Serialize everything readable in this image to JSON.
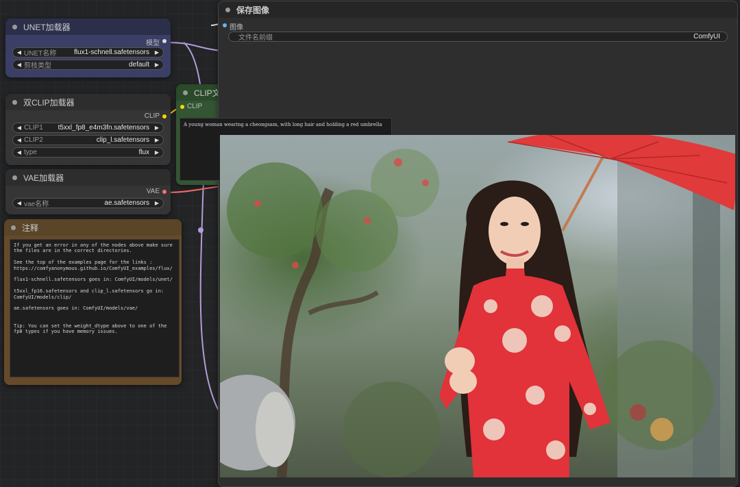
{
  "unet_loader": {
    "title": "UNET加载器",
    "output_label": "模型",
    "widgets": [
      {
        "label": "UNET名称",
        "value": "flux1-schnell.safetensors"
      },
      {
        "label": "剪枝类型",
        "value": "default"
      }
    ]
  },
  "dual_clip_loader": {
    "title": "双CLIP加载器",
    "output_label": "CLIP",
    "widgets": [
      {
        "label": "CLIP1",
        "value": "t5xxl_fp8_e4m3fn.safetensors"
      },
      {
        "label": "CLIP2",
        "value": "clip_l.safetensors"
      },
      {
        "label": "type",
        "value": "flux"
      }
    ]
  },
  "vae_loader": {
    "title": "VAE加载器",
    "output_label": "VAE",
    "widgets": [
      {
        "label": "vae名称",
        "value": "ae.safetensors"
      }
    ]
  },
  "note": {
    "title": "注释",
    "text": "If you get an error in any of the nodes above make sure the files are in the correct directories.\n\nSee the top of the examples page for the links :\nhttps://comfyanonymous.github.io/ComfyUI_examples/flux/\n\nflux1-schnell.safetensors goes in: ComfyUI/models/unet/\n\nt5xxl_fp16.safetensors and clip_l.safetensors go in:\nComfyUI/models/clip/\n\nae.safetensors goes in: ComfyUI/models/vae/\n\n\nTip: You can set the weight_dtype above to one of the fp8 types if you have memory issues."
  },
  "clip_text_encode": {
    "title": "CLIP文本",
    "input_label": "CLIP",
    "prompt": "A young woman wearing a cheongsam, with long hair and holding a red umbrella"
  },
  "save_image": {
    "title": "保存图像",
    "input_label": "图像",
    "widget": {
      "label": "文件名前缀",
      "value": "ComfyUI"
    }
  },
  "colors": {
    "model_wire": "#b39ddb",
    "clip_wire": "#ffd500",
    "vae_wire": "#ff6e6e",
    "image_wire": "#64b5f6",
    "unet_header": "#2b2f4a",
    "unet_body": "#3b3f66",
    "clip_node_header": "#2a4a2a",
    "clip_node_body": "#335533",
    "note_header": "#5a4528",
    "note_body": "#664a2a"
  }
}
